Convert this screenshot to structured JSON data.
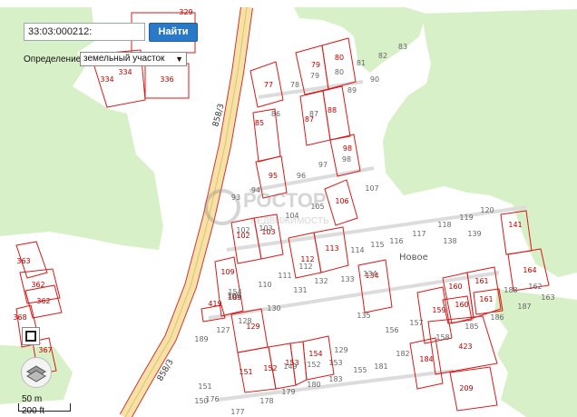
{
  "search": {
    "value": "33:03:000212:",
    "button_label": "Найти"
  },
  "definition": {
    "label": "Определение:",
    "selected": "земельный участок"
  },
  "scale": {
    "metric": "50 m",
    "imperial": "200 ft"
  },
  "watermark": {
    "line1": "РОСТОР",
    "line2": "НЕДВИЖИМОСТЬ"
  },
  "road_labels": [
    "858/3",
    "858/3"
  ],
  "locality_label": "Новое",
  "parcels_red": [
    "329",
    "336",
    "334",
    "334",
    "77",
    "79",
    "80",
    "85",
    "87",
    "88",
    "98",
    "95",
    "106",
    "102",
    "103",
    "109",
    "112",
    "113",
    "134",
    "419",
    "109",
    "129",
    "151",
    "152",
    "153",
    "154",
    "160",
    "161",
    "161",
    "159",
    "160",
    "423",
    "184",
    "209",
    "141",
    "164",
    "362",
    "362",
    "363",
    "368",
    "367"
  ],
  "parcels_gray": [
    "81",
    "82",
    "83",
    "78",
    "79",
    "80",
    "90",
    "89",
    "86",
    "87",
    "97",
    "96",
    "107",
    "93",
    "94",
    "104",
    "105",
    "98",
    "101",
    "102",
    "103",
    "112",
    "114",
    "115",
    "116",
    "117",
    "118",
    "119",
    "120",
    "138",
    "139",
    "111",
    "110",
    "109",
    "130",
    "131",
    "132",
    "133",
    "134",
    "135",
    "156",
    "157",
    "158",
    "185",
    "186",
    "187",
    "188",
    "162",
    "163",
    "189",
    "127",
    "128",
    "129",
    "155",
    "181",
    "182",
    "183",
    "180",
    "179",
    "178",
    "177",
    "176",
    "151",
    "150",
    "149",
    "152",
    "153",
    "154",
    "100"
  ],
  "colors": {
    "forest": "#d8f0c8",
    "road_fill": "#f6e2a6",
    "parcel_red": "#d81a1a",
    "parcel_gray": "#9a9a9a",
    "accent": "#2a79c9"
  }
}
